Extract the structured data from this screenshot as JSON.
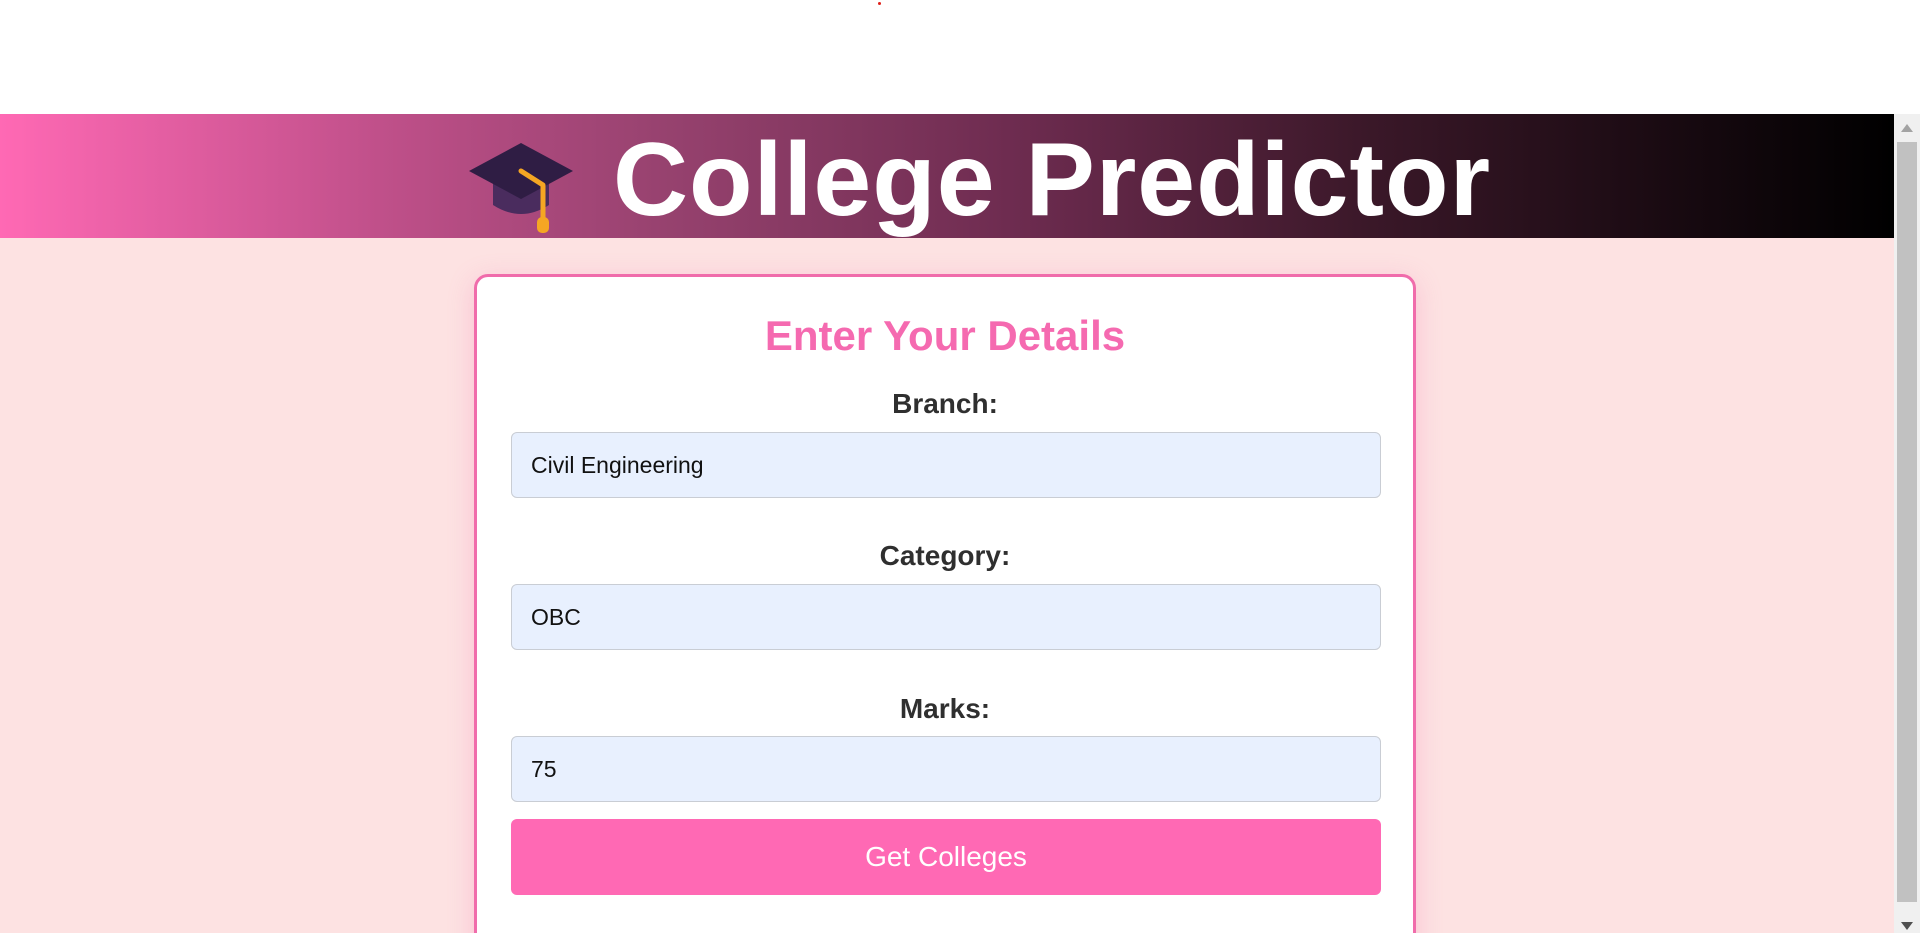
{
  "header": {
    "title": "College Predictor",
    "icon": "graduation-cap-icon",
    "gradient_start": "#ff69b4",
    "gradient_end": "#000000"
  },
  "form": {
    "title": "Enter Your Details",
    "branch_label": "Branch:",
    "branch_value": "Civil Engineering",
    "category_label": "Category:",
    "category_value": "OBC",
    "marks_label": "Marks:",
    "marks_value": "75",
    "submit_label": "Get Colleges"
  },
  "colors": {
    "accent": "#ff69b4",
    "page_background": "#fde2e2",
    "input_background": "#e8f0fe"
  }
}
